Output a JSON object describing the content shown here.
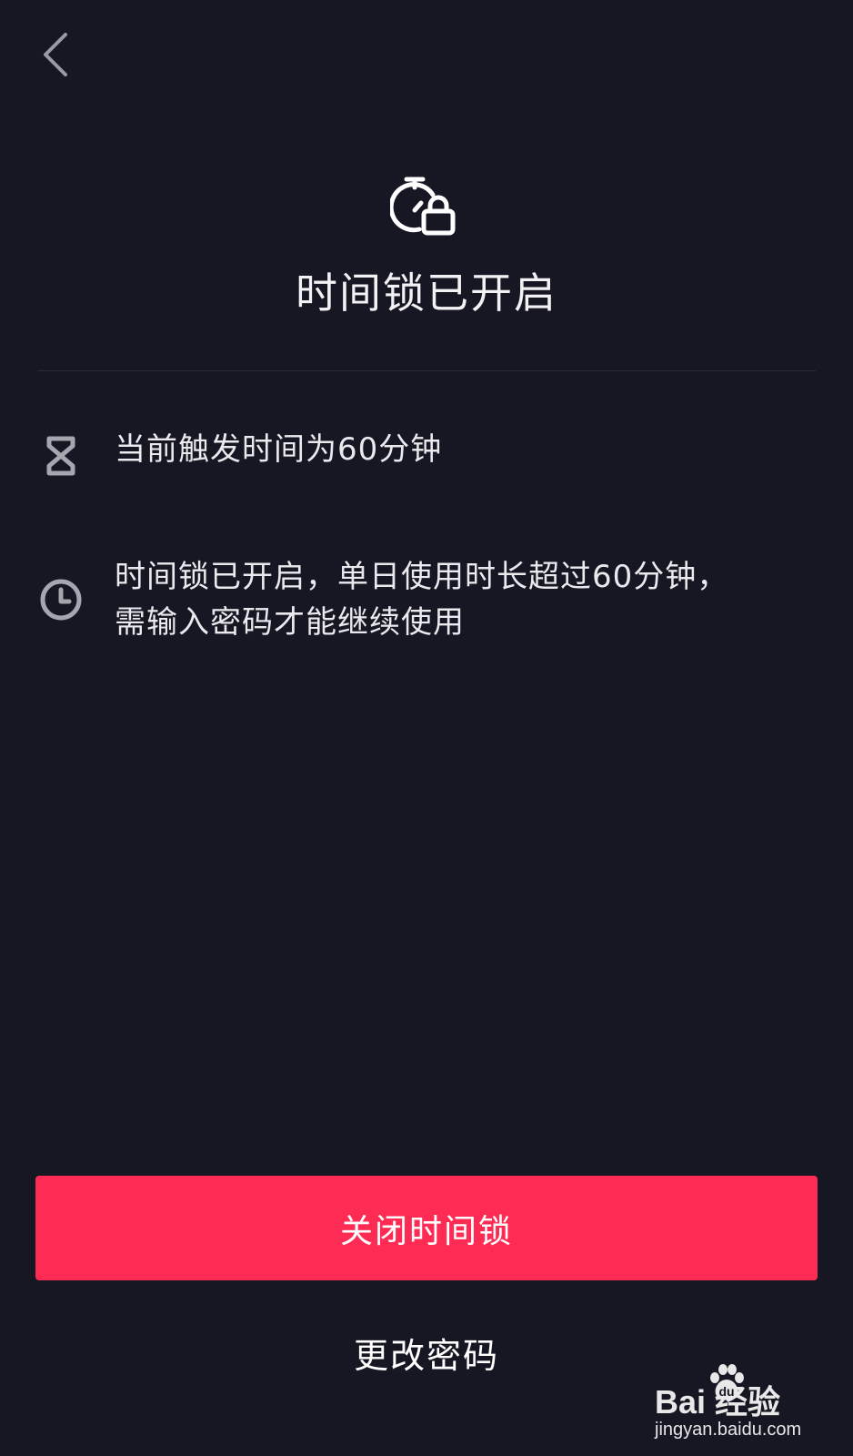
{
  "nav": {
    "back_icon": "chevron-left-icon"
  },
  "header": {
    "icon": "stopwatch-lock-icon",
    "title": "时间锁已开启"
  },
  "info": {
    "items": [
      {
        "icon": "hourglass-icon",
        "lines": [
          "当前触发时间为60分钟"
        ]
      },
      {
        "icon": "clock-icon",
        "lines": [
          "时间锁已开启，单日使用时长超过60分钟，",
          "需输入密码才能继续使用"
        ]
      }
    ]
  },
  "actions": {
    "primary_label": "关闭时间锁",
    "secondary_label": "更改密码"
  },
  "watermark": {
    "brand": "Bai  经验",
    "url": "jingyan.baidu.com"
  },
  "colors": {
    "background": "#171724",
    "accent": "#fe2c55",
    "text": "#ffffff",
    "icon_gray": "#a6a6ae"
  }
}
